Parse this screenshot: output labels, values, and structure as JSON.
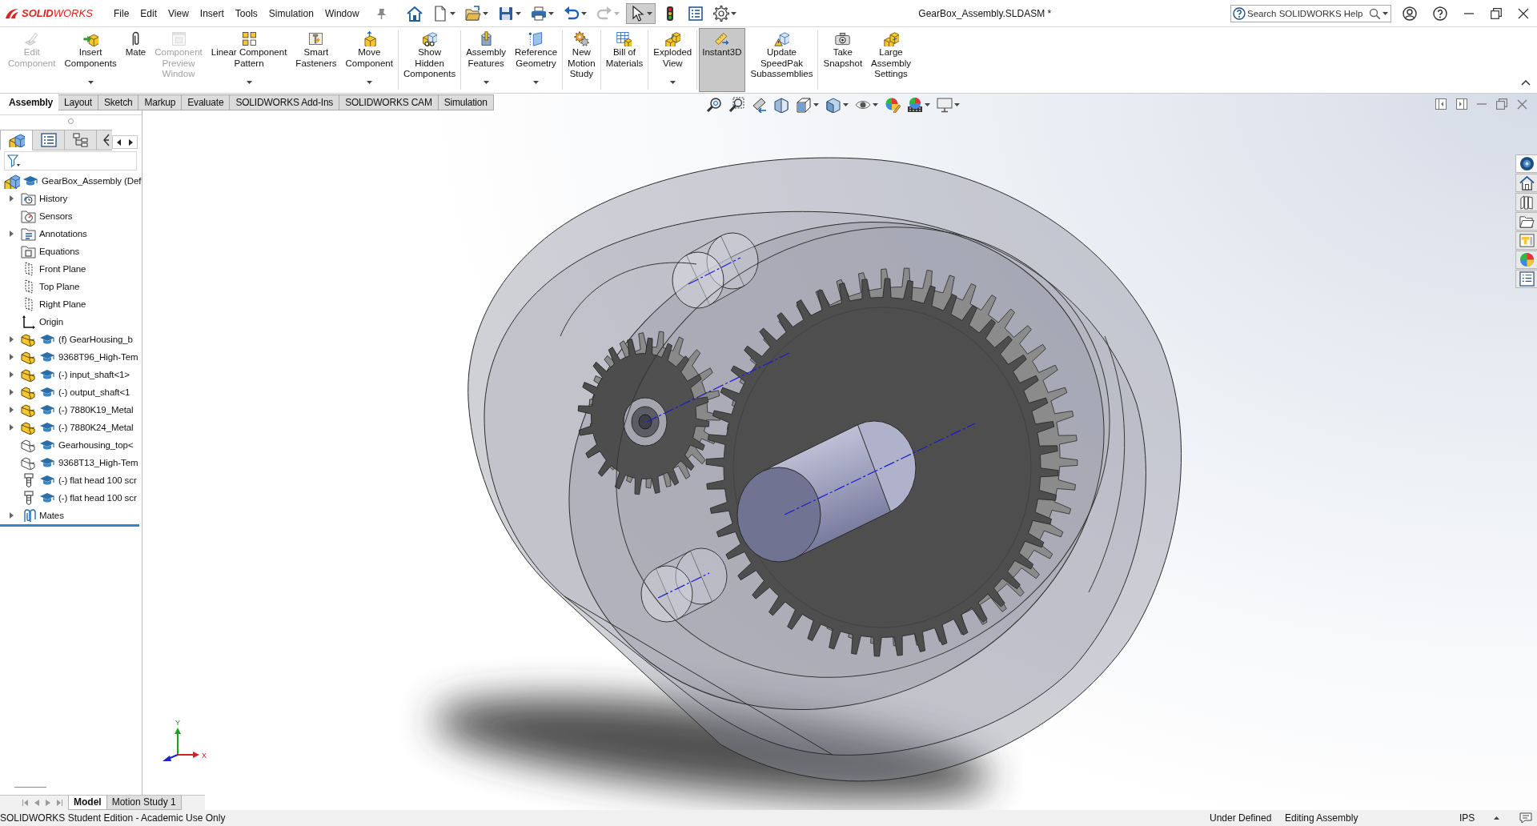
{
  "title_bar": {
    "logo": "**SOLID**WORKS",
    "menu": [
      "File",
      "Edit",
      "View",
      "Insert",
      "Tools",
      "Simulation",
      "Window"
    ],
    "quick_access": [
      {
        "disabled": false,
        "selected": false
      },
      {
        "disabled": false,
        "selected": false
      },
      {
        "disabled": false,
        "selected": false
      },
      {
        "disabled": false,
        "selected": false
      },
      {
        "disabled": false,
        "selected": false
      },
      {
        "disabled": false,
        "selected": false
      },
      {
        "disabled": true,
        "selected": false
      },
      {
        "disabled": false,
        "selected": true
      },
      {
        "disabled": false,
        "selected": false
      },
      {
        "disabled": false,
        "selected": false
      },
      {
        "disabled": false,
        "selected": false
      }
    ],
    "document_title": "GearBox_Assembly.SLDASM *",
    "search": {
      "placeholder": "Search SOLIDWORKS Help"
    }
  },
  "command_manager": {
    "groups": [
      {
        "buttons": [
          {
            "lines": [
              "Edit",
              "Component"
            ],
            "disabled": true,
            "selected": false,
            "has_menu": false
          },
          {
            "lines": [
              "Insert",
              "Components"
            ],
            "disabled": false,
            "selected": false,
            "has_menu": true
          },
          {
            "lines": [
              "Mate"
            ],
            "disabled": false,
            "selected": false,
            "has_menu": false
          },
          {
            "lines": [
              "Component",
              "Preview",
              "Window"
            ],
            "disabled": true,
            "selected": false,
            "has_menu": false
          },
          {
            "lines": [
              "Linear Component",
              "Pattern"
            ],
            "disabled": false,
            "selected": false,
            "has_menu": true
          },
          {
            "lines": [
              "Smart",
              "Fasteners"
            ],
            "disabled": false,
            "selected": false,
            "has_menu": false
          },
          {
            "lines": [
              "Move",
              "Component"
            ],
            "disabled": false,
            "selected": false,
            "has_menu": true
          }
        ]
      },
      {
        "buttons": [
          {
            "lines": [
              "Show",
              "Hidden",
              "Components"
            ],
            "disabled": false,
            "selected": false,
            "has_menu": false
          }
        ]
      },
      {
        "buttons": [
          {
            "lines": [
              "Assembly",
              "Features"
            ],
            "disabled": false,
            "selected": false,
            "has_menu": true
          },
          {
            "lines": [
              "Reference",
              "Geometry"
            ],
            "disabled": false,
            "selected": false,
            "has_menu": true
          }
        ]
      },
      {
        "buttons": [
          {
            "lines": [
              "New",
              "Motion",
              "Study"
            ],
            "disabled": false,
            "selected": false,
            "has_menu": false
          }
        ]
      },
      {
        "buttons": [
          {
            "lines": [
              "Bill of",
              "Materials"
            ],
            "disabled": false,
            "selected": false,
            "has_menu": false
          }
        ]
      },
      {
        "buttons": [
          {
            "lines": [
              "Exploded",
              "View"
            ],
            "disabled": false,
            "selected": false,
            "has_menu": true
          }
        ]
      },
      {
        "buttons": [
          {
            "lines": [
              "Instant3D"
            ],
            "disabled": false,
            "selected": true,
            "has_menu": false
          },
          {
            "lines": [
              "Update",
              "SpeedPak",
              "Subassemblies"
            ],
            "disabled": false,
            "selected": false,
            "has_menu": false
          }
        ]
      },
      {
        "buttons": [
          {
            "lines": [
              "Take",
              "Snapshot"
            ],
            "disabled": false,
            "selected": false,
            "has_menu": false
          },
          {
            "lines": [
              "Large",
              "Assembly",
              "Settings"
            ],
            "disabled": false,
            "selected": false,
            "has_menu": false
          }
        ]
      }
    ]
  },
  "command_tabs": [
    {
      "label": "Assembly",
      "selected": true
    },
    {
      "label": "Layout",
      "selected": false
    },
    {
      "label": "Sketch",
      "selected": false
    },
    {
      "label": "Markup",
      "selected": false
    },
    {
      "label": "Evaluate",
      "selected": false
    },
    {
      "label": "SOLIDWORKS Add-Ins",
      "selected": false
    },
    {
      "label": "SOLIDWORKS CAM",
      "selected": false
    },
    {
      "label": "Simulation",
      "selected": false
    }
  ],
  "feature_tree": {
    "tabs": [
      {
        "selected": true
      },
      {
        "selected": false
      },
      {
        "selected": false
      },
      {
        "selected": false
      }
    ],
    "items": [
      {
        "label": "GearBox_Assembly (Def",
        "kind": "assembly",
        "children": [
          {
            "label": "History",
            "kind": "history",
            "expanded": false
          },
          {
            "label": "Sensors",
            "kind": "sensors"
          },
          {
            "label": "Annotations",
            "kind": "annotations",
            "expanded": false
          },
          {
            "label": "Equations",
            "kind": "equations"
          },
          {
            "label": "Front Plane",
            "kind": "plane"
          },
          {
            "label": "Top Plane",
            "kind": "plane"
          },
          {
            "label": "Right Plane",
            "kind": "plane"
          },
          {
            "label": "Origin",
            "kind": "origin"
          },
          {
            "label": "(f) GearHousing_b",
            "kind": "part",
            "hidden": false,
            "expanded": false
          },
          {
            "label": "9368T96_High-Tem",
            "kind": "part",
            "hidden": false,
            "expanded": false
          },
          {
            "label": "(-) input_shaft<1>",
            "kind": "part",
            "hidden": false,
            "expanded": false
          },
          {
            "label": "(-) output_shaft<1",
            "kind": "part",
            "hidden": false,
            "expanded": false
          },
          {
            "label": "(-) 7880K19_Metal",
            "kind": "part",
            "hidden": false,
            "expanded": false
          },
          {
            "label": "(-) 7880K24_Metal",
            "kind": "part",
            "hidden": false,
            "expanded": false
          },
          {
            "label": "Gearhousing_top<",
            "kind": "part",
            "hidden": true
          },
          {
            "label": "9368T13_High-Tem",
            "kind": "part",
            "hidden": true
          },
          {
            "label": "(-) flat head 100 scr",
            "kind": "fastener"
          },
          {
            "label": "(-) flat head 100 scr",
            "kind": "fastener"
          },
          {
            "label": "Mates",
            "kind": "mates",
            "expanded": false
          }
        ]
      }
    ]
  },
  "task_pane": [
    {
      "selected": true
    },
    {
      "selected": false
    },
    {
      "selected": false
    },
    {
      "selected": false
    },
    {
      "selected": false
    },
    {
      "selected": false
    },
    {
      "selected": false
    }
  ],
  "triad": {
    "y_label": "Y",
    "x_label": "X"
  },
  "document_tabs": [
    {
      "label": "Model",
      "selected": true
    },
    {
      "label": "Motion Study 1",
      "selected": false
    }
  ],
  "status_bar": {
    "edition": "SOLIDWORKS Student Edition - Academic Use Only",
    "state": "Under Defined",
    "mode": "Editing Assembly",
    "units": "IPS"
  }
}
